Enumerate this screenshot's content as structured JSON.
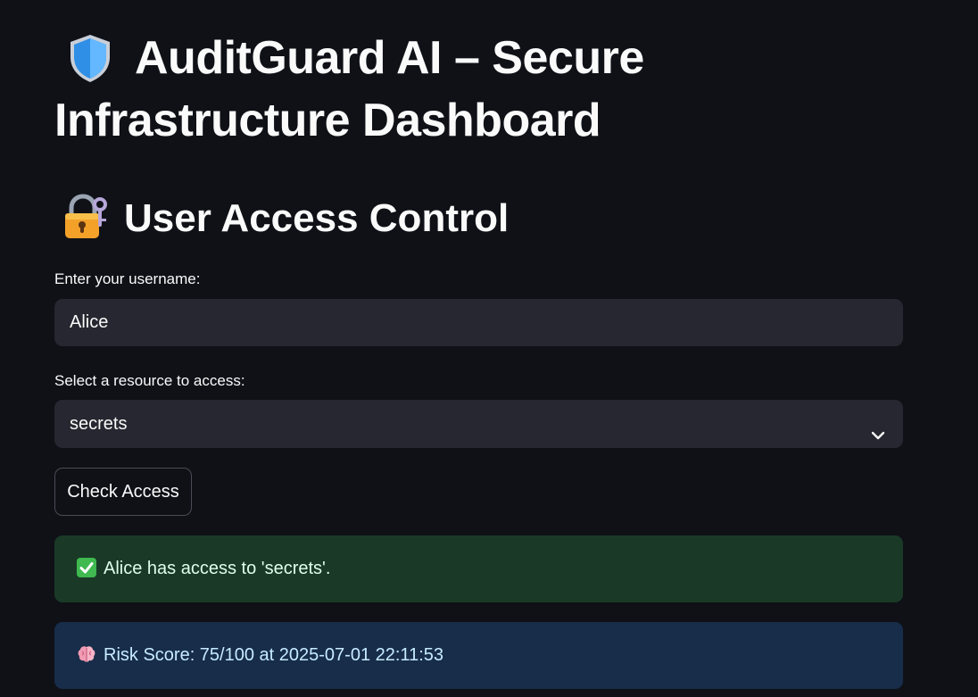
{
  "header": {
    "title": "AuditGuard AI – Secure Infrastructure Dashboard",
    "title_icon": "shield-icon"
  },
  "section": {
    "heading": "User Access Control",
    "heading_icon": "lock-with-key-icon"
  },
  "form": {
    "username_label": "Enter your username:",
    "username_value": "Alice",
    "resource_label": "Select a resource to access:",
    "resource_selected": "secrets",
    "check_button_label": "Check Access"
  },
  "alerts": {
    "success_icon": "check-mark-icon",
    "success_text": "Alice has access to 'secrets'.",
    "info_icon": "brain-icon",
    "info_text": "Risk Score: 75/100 at 2025-07-01 22:11:53"
  },
  "colors": {
    "background": "#0f1117",
    "input_background": "#262730",
    "success_background": "#1a3a27",
    "info_background": "#172d4a",
    "text": "#fafafa"
  }
}
